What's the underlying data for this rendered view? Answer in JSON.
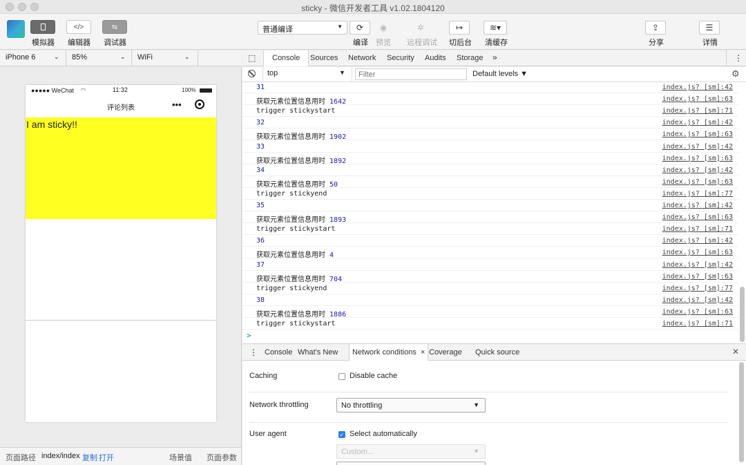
{
  "window": {
    "title": "sticky - 微信开发者工具 v1.02.1804120"
  },
  "toolbar": {
    "simulator_label": "模拟器",
    "editor_label": "编辑器",
    "debugger_label": "调试器",
    "editor_icon": "</>",
    "compile_mode": "普通编译",
    "compile_label": "编译",
    "preview_label": "预览",
    "remote_debug_label": "远程调试",
    "background_label": "切后台",
    "clear_cache_label": "清缓存",
    "share_label": "分享",
    "details_label": "详情"
  },
  "simulator": {
    "device": "iPhone 6",
    "zoom": "85%",
    "network": "WiFi",
    "status_carrier": "●●●●● WeChat",
    "status_time": "11:32",
    "status_battery": "100%",
    "nav_title": "评论列表",
    "nav_dots": "•••",
    "sticky_text": "I am sticky!!"
  },
  "footer": {
    "path_label": "页面路径",
    "path_value": "index/index",
    "copy": "复制",
    "open": "打开",
    "scene": "场景值",
    "params": "页面参数"
  },
  "devtools": {
    "tabs": [
      "Console",
      "Sources",
      "Network",
      "Security",
      "Audits",
      "Storage"
    ],
    "more": "»",
    "context": "top",
    "filter_placeholder": "Filter",
    "levels": "Default levels ▼",
    "prompt": ">"
  },
  "console_logs": [
    {
      "msg": "31",
      "num": "",
      "src": "index.js? [sm]:42",
      "kind": "num"
    },
    {
      "msg": "获取元素位置信息用时 ",
      "num": "1642",
      "src": "index.js? [sm]:63",
      "kind": "timing"
    },
    {
      "msg": "trigger stickystart",
      "num": "",
      "src": "index.js? [sm]:71",
      "kind": "text"
    },
    {
      "msg": "32",
      "num": "",
      "src": "index.js? [sm]:42",
      "kind": "num"
    },
    {
      "msg": "获取元素位置信息用时 ",
      "num": "1902",
      "src": "index.js? [sm]:63",
      "kind": "timing"
    },
    {
      "msg": "33",
      "num": "",
      "src": "index.js? [sm]:42",
      "kind": "num"
    },
    {
      "msg": "获取元素位置信息用时 ",
      "num": "1892",
      "src": "index.js? [sm]:63",
      "kind": "timing"
    },
    {
      "msg": "34",
      "num": "",
      "src": "index.js? [sm]:42",
      "kind": "num"
    },
    {
      "msg": "获取元素位置信息用时 ",
      "num": "50",
      "src": "index.js? [sm]:63",
      "kind": "timing"
    },
    {
      "msg": "trigger stickyend",
      "num": "",
      "src": "index.js? [sm]:77",
      "kind": "text"
    },
    {
      "msg": "35",
      "num": "",
      "src": "index.js? [sm]:42",
      "kind": "num"
    },
    {
      "msg": "获取元素位置信息用时 ",
      "num": "1893",
      "src": "index.js? [sm]:63",
      "kind": "timing"
    },
    {
      "msg": "trigger stickystart",
      "num": "",
      "src": "index.js? [sm]:71",
      "kind": "text"
    },
    {
      "msg": "36",
      "num": "",
      "src": "index.js? [sm]:42",
      "kind": "num"
    },
    {
      "msg": "获取元素位置信息用时 ",
      "num": "4",
      "src": "index.js? [sm]:63",
      "kind": "timing"
    },
    {
      "msg": "37",
      "num": "",
      "src": "index.js? [sm]:42",
      "kind": "num"
    },
    {
      "msg": "获取元素位置信息用时 ",
      "num": "704",
      "src": "index.js? [sm]:63",
      "kind": "timing"
    },
    {
      "msg": "trigger stickyend",
      "num": "",
      "src": "index.js? [sm]:77",
      "kind": "text"
    },
    {
      "msg": "38",
      "num": "",
      "src": "index.js? [sm]:42",
      "kind": "num"
    },
    {
      "msg": "获取元素位置信息用时 ",
      "num": "1886",
      "src": "index.js? [sm]:63",
      "kind": "timing"
    },
    {
      "msg": "trigger stickystart",
      "num": "",
      "src": "index.js? [sm]:71",
      "kind": "text"
    }
  ],
  "drawer": {
    "tabs": [
      "Console",
      "What's New",
      "Network conditions",
      "Coverage",
      "Quick source"
    ],
    "close_tab": "×",
    "close": "✕",
    "caching_label": "Caching",
    "disable_cache": "Disable cache",
    "disable_cache_checked": false,
    "throttling_label": "Network throttling",
    "throttling_value": "No throttling",
    "user_agent_label": "User agent",
    "select_automatically": "Select automatically",
    "select_automatically_checked": true,
    "custom_placeholder": "Custom..."
  },
  "colors": {
    "sticky_bg": "#ffff22",
    "console_number": "#1a1aa6",
    "checkbox_checked": "#2e7ee6"
  }
}
